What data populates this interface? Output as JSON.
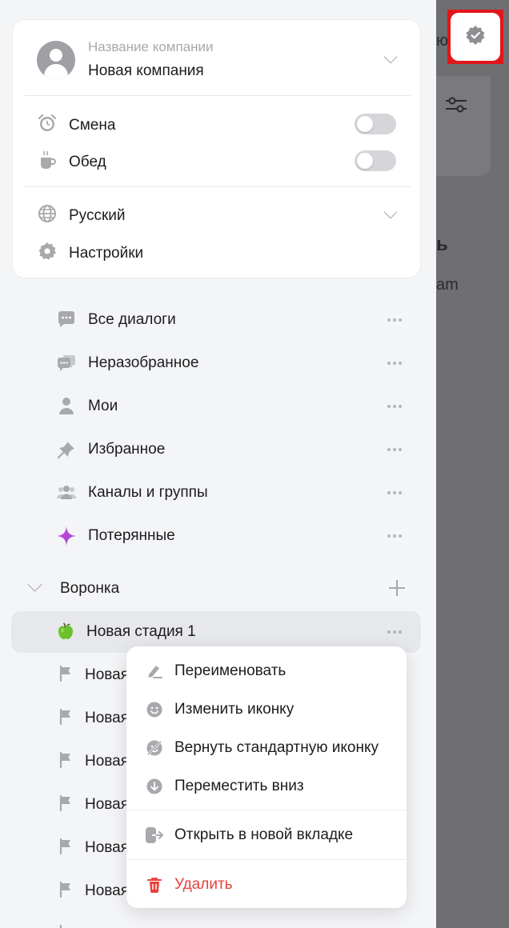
{
  "background": {
    "peek_text_1": "ю",
    "peek_text_2": "ь",
    "peek_text_3": "am",
    "corner_button_icon": "verified-badge-icon"
  },
  "company": {
    "caption": "Название компании",
    "name": "Новая компания"
  },
  "settings_card": {
    "shift_label": "Смена",
    "shift_on": false,
    "lunch_label": "Обед",
    "lunch_on": false,
    "language_label": "Русский",
    "settings_label": "Настройки"
  },
  "nav": {
    "items": [
      {
        "label": "Все диалоги",
        "icon": "chat-bubble-icon"
      },
      {
        "label": "Неразобранное",
        "icon": "chat-bubbles-icon"
      },
      {
        "label": "Мои",
        "icon": "person-icon"
      },
      {
        "label": "Избранное",
        "icon": "pin-icon"
      },
      {
        "label": "Каналы и группы",
        "icon": "group-icon"
      },
      {
        "label": "Потерянные",
        "icon": "sparkle-icon"
      }
    ]
  },
  "funnel": {
    "label": "Воронка",
    "stages": [
      {
        "label": "Новая стадия 1",
        "icon": "green-apple-icon"
      },
      {
        "label": "Новая",
        "icon": "flag-icon"
      },
      {
        "label": "Новая",
        "icon": "flag-icon"
      },
      {
        "label": "Новая",
        "icon": "flag-icon"
      },
      {
        "label": "Новая",
        "icon": "flag-icon"
      },
      {
        "label": "Новая",
        "icon": "flag-icon"
      },
      {
        "label": "Новая",
        "icon": "flag-icon"
      }
    ]
  },
  "context_menu": {
    "rename": "Переименовать",
    "change_icon": "Изменить иконку",
    "reset_icon": "Вернуть стандартную иконку",
    "move_down": "Переместить вниз",
    "open_new_tab": "Открыть в новой вкладке",
    "delete": "Удалить"
  },
  "colors": {
    "danger": "#e8413b",
    "highlight_border": "#e0161b",
    "sparkle": "#c04bd6"
  }
}
